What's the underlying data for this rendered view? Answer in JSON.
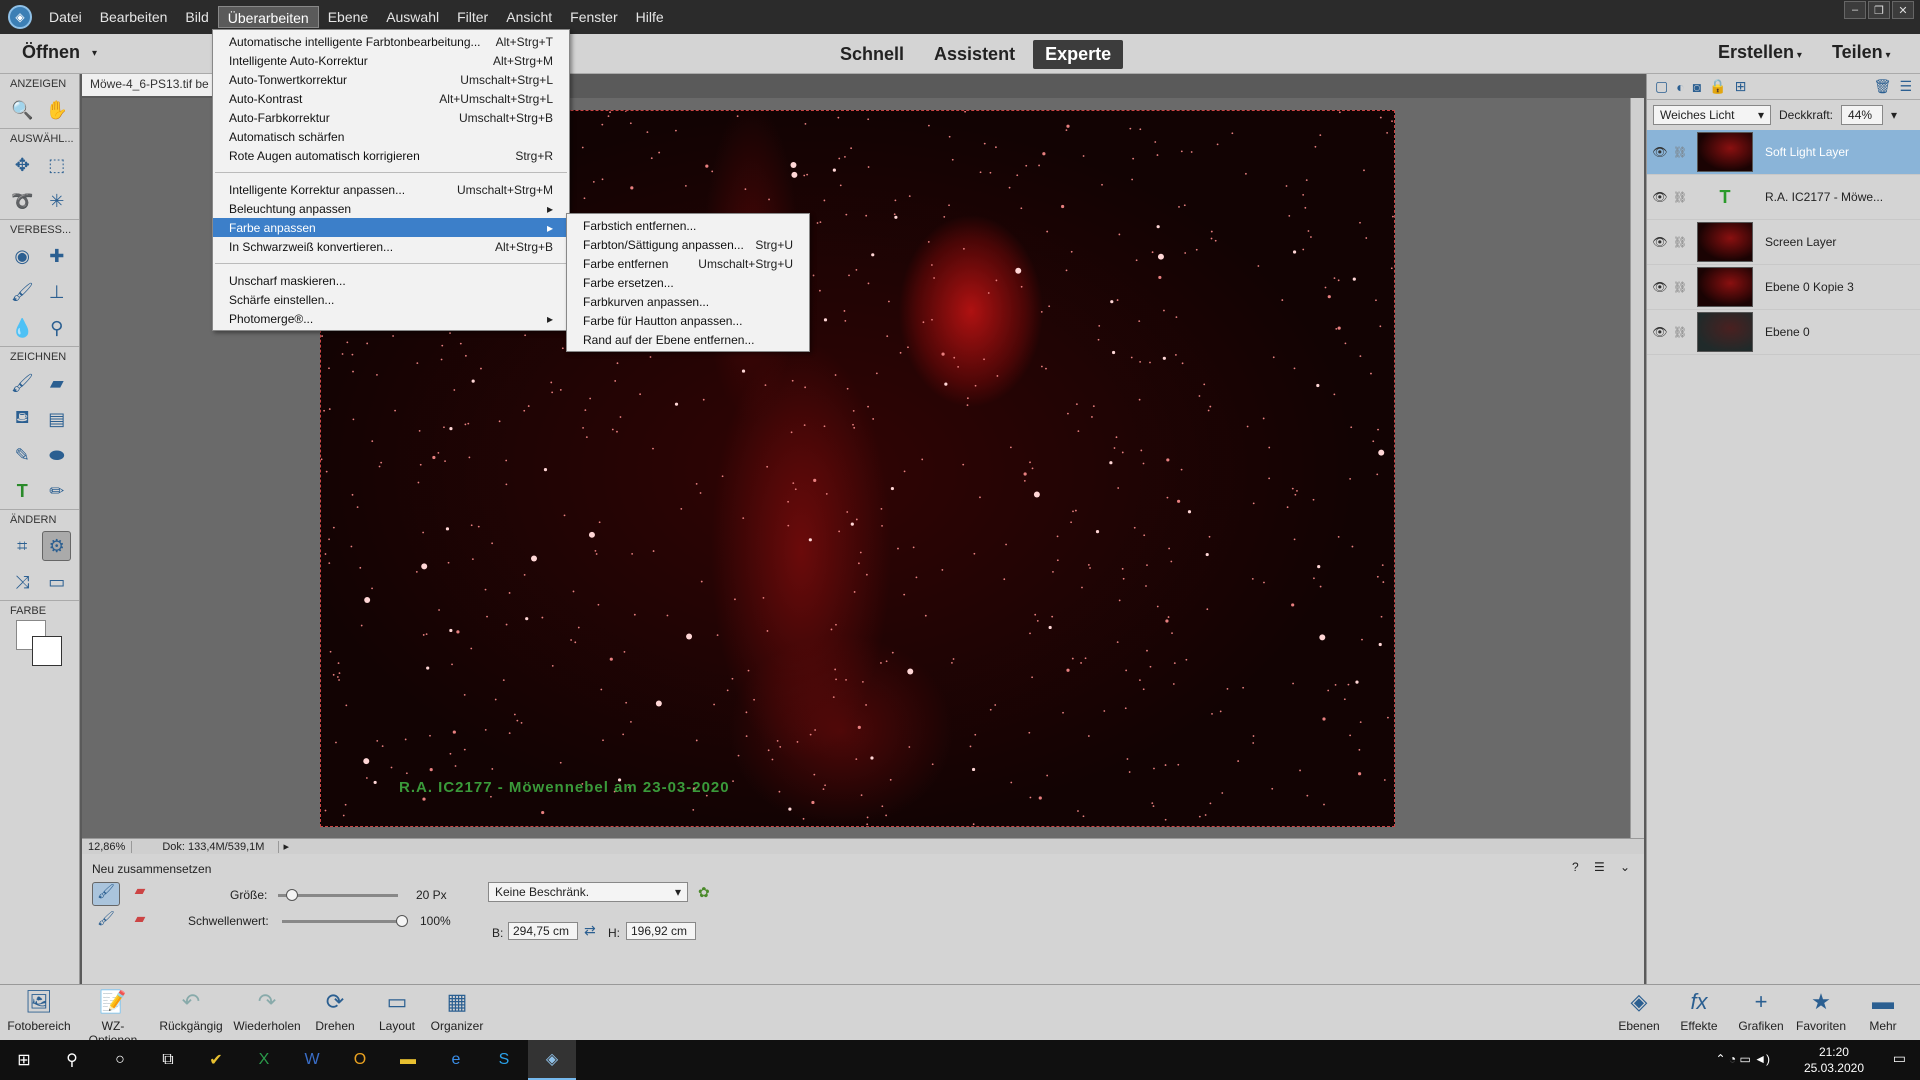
{
  "menubar": {
    "items": [
      "Datei",
      "Bearbeiten",
      "Bild",
      "Überarbeiten",
      "Ebene",
      "Auswahl",
      "Filter",
      "Ansicht",
      "Fenster",
      "Hilfe"
    ],
    "active": "Überarbeiten"
  },
  "modebar": {
    "open_label": "Öffnen",
    "tabs": [
      "Schnell",
      "Assistent",
      "Experte"
    ],
    "active_tab": "Experte",
    "create_label": "Erstellen",
    "share_label": "Teilen"
  },
  "toolbar": {
    "sections": [
      "ANZEIGEN",
      "AUSWÄHL...",
      "VERBESS...",
      "ZEICHNEN",
      "ÄNDERN",
      "FARBE"
    ]
  },
  "document": {
    "tab_title": "Möwe-4_6-PS13.tif be",
    "caption": "R.A. IC2177 - Möwennebel am 23-03-2020",
    "zoom": "12,86%",
    "doc_size": "Dok: 133,4M/539,1M"
  },
  "menu_overarbeiten": {
    "items": [
      {
        "label": "Automatische intelligente Farbtonbearbeitung...",
        "shortcut": "Alt+Strg+T"
      },
      {
        "label": "Intelligente Auto-Korrektur",
        "shortcut": "Alt+Strg+M"
      },
      {
        "label": "Auto-Tonwertkorrektur",
        "shortcut": "Umschalt+Strg+L"
      },
      {
        "label": "Auto-Kontrast",
        "shortcut": "Alt+Umschalt+Strg+L"
      },
      {
        "label": "Auto-Farbkorrektur",
        "shortcut": "Umschalt+Strg+B"
      },
      {
        "label": "Automatisch schärfen",
        "shortcut": ""
      },
      {
        "label": "Rote Augen automatisch korrigieren",
        "shortcut": "Strg+R"
      },
      {
        "label": "Intelligente Korrektur anpassen...",
        "shortcut": "Umschalt+Strg+M"
      },
      {
        "label": "Beleuchtung anpassen",
        "shortcut": "▸"
      },
      {
        "label": "Farbe anpassen",
        "shortcut": "▸"
      },
      {
        "label": "In Schwarzweiß konvertieren...",
        "shortcut": "Alt+Strg+B"
      },
      {
        "label": "Unscharf maskieren...",
        "shortcut": ""
      },
      {
        "label": "Schärfe einstellen...",
        "shortcut": ""
      },
      {
        "label": "Photomerge®...",
        "shortcut": "▸"
      }
    ]
  },
  "submenu_farbe": {
    "items": [
      {
        "label": "Farbstich entfernen...",
        "shortcut": ""
      },
      {
        "label": "Farbton/Sättigung anpassen...",
        "shortcut": "Strg+U"
      },
      {
        "label": "Farbe entfernen",
        "shortcut": "Umschalt+Strg+U"
      },
      {
        "label": "Farbe ersetzen...",
        "shortcut": ""
      },
      {
        "label": "Farbkurven anpassen...",
        "shortcut": ""
      },
      {
        "label": "Farbe für Hautton anpassen...",
        "shortcut": ""
      },
      {
        "label": "Rand auf der Ebene entfernen...",
        "shortcut": ""
      }
    ]
  },
  "layers_panel": {
    "blend_mode": "Weiches Licht",
    "opacity_label": "Deckkraft:",
    "opacity_value": "44%",
    "layers": [
      {
        "name": "Soft Light Layer"
      },
      {
        "name": "R.A. IC2177 - Möwe..."
      },
      {
        "name": "Screen Layer"
      },
      {
        "name": "Ebene 0 Kopie 3"
      },
      {
        "name": "Ebene 0"
      }
    ]
  },
  "tool_options": {
    "tool_name": "Neu zusammensetzen",
    "size_label": "Größe:",
    "size_value": "20 Px",
    "size_fraction": 0.12,
    "threshold_label": "Schwellenwert:",
    "threshold_value": "100%",
    "threshold_fraction": 1.0,
    "constraint": "Keine Beschränk.",
    "width_label": "B:",
    "width_value": "294,75 cm",
    "height_label": "H:",
    "height_value": "196,92 cm"
  },
  "bottombar": {
    "left": [
      "Fotobereich",
      "WZ-Optionen",
      "Rückgängig",
      "Wiederholen",
      "Drehen",
      "Layout",
      "Organizer"
    ],
    "right": [
      "Ebenen",
      "Effekte",
      "Grafiken",
      "Favoriten",
      "Mehr"
    ]
  },
  "taskbar": {
    "time": "21:20",
    "date": "25.03.2020"
  }
}
